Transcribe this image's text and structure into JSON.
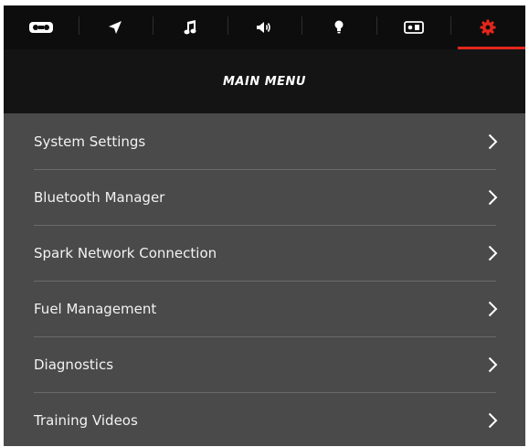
{
  "colors": {
    "accent": "#e3261c",
    "icon": "#ffffff",
    "background": "#4a4a4a",
    "header": "#141414",
    "tabbar": "#0d0d0d"
  },
  "tabs": [
    {
      "id": "tape",
      "icon": "cassette-icon",
      "active": false
    },
    {
      "id": "navigation",
      "icon": "navigation-arrow-icon",
      "active": false
    },
    {
      "id": "music",
      "icon": "music-note-icon",
      "active": false
    },
    {
      "id": "volume",
      "icon": "speaker-icon",
      "active": false
    },
    {
      "id": "lights",
      "icon": "light-bulb-icon",
      "active": false
    },
    {
      "id": "device",
      "icon": "device-icon",
      "active": false
    },
    {
      "id": "settings",
      "icon": "gear-icon",
      "active": true
    }
  ],
  "header": {
    "title": "MAIN MENU"
  },
  "menu": {
    "items": [
      {
        "label": "System Settings",
        "icon": "chevron-right-icon"
      },
      {
        "label": "Bluetooth Manager",
        "icon": "chevron-right-icon"
      },
      {
        "label": "Spark Network Connection",
        "icon": "chevron-right-icon"
      },
      {
        "label": "Fuel Management",
        "icon": "chevron-right-icon"
      },
      {
        "label": "Diagnostics",
        "icon": "chevron-right-icon"
      },
      {
        "label": "Training Videos",
        "icon": "chevron-right-icon"
      }
    ]
  }
}
